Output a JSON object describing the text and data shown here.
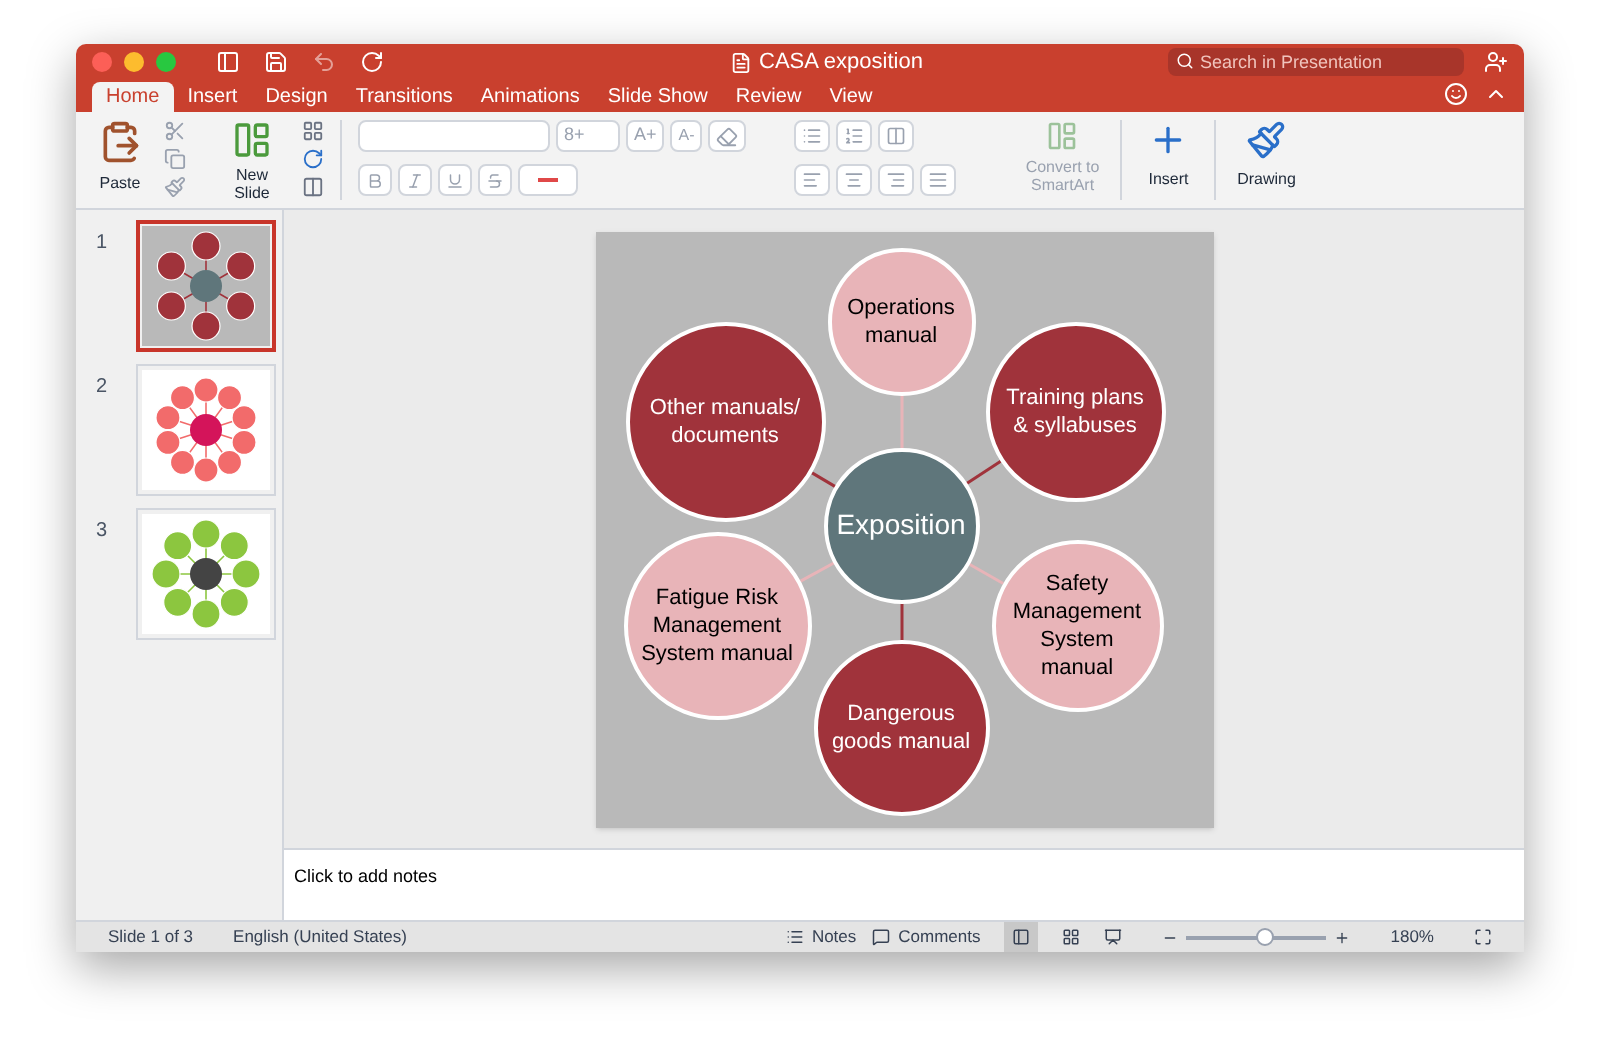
{
  "window": {
    "title": "CASA exposition"
  },
  "search": {
    "placeholder": "Search in Presentation"
  },
  "tabs": [
    {
      "label": "Home",
      "selected": true
    },
    {
      "label": "Insert",
      "selected": false
    },
    {
      "label": "Design",
      "selected": false
    },
    {
      "label": "Transitions",
      "selected": false
    },
    {
      "label": "Animations",
      "selected": false
    },
    {
      "label": "Slide Show",
      "selected": false
    },
    {
      "label": "Review",
      "selected": false
    },
    {
      "label": "View",
      "selected": false
    }
  ],
  "ribbon": {
    "paste": "Paste",
    "new_slide": "New Slide",
    "font_size": "8+",
    "grow_font": "A+",
    "shrink_font": "A-",
    "convert": "Convert to SmartArt",
    "insert": "Insert",
    "drawing": "Drawing"
  },
  "slides": [
    {
      "number": "1",
      "selected": true,
      "kind": "six",
      "color": "#a0333b"
    },
    {
      "number": "2",
      "selected": false,
      "kind": "ten",
      "color": "#f26b6b"
    },
    {
      "number": "3",
      "selected": false,
      "kind": "eight",
      "color": "#8cc63f"
    }
  ],
  "diagram": {
    "center": "Exposition",
    "nodes": [
      {
        "label": "Operations manual",
        "color": "#e8b4b8"
      },
      {
        "label": "Other manuals/ documents",
        "color": "#a0333b"
      },
      {
        "label": "Training plans & syllabuses",
        "color": "#a0333b"
      },
      {
        "label": "Fatigue Risk Management System manual",
        "color": "#e8b4b8"
      },
      {
        "label": "Safety Management System manual",
        "color": "#e8b4b8"
      },
      {
        "label": "Dangerous goods manual",
        "color": "#a0333b"
      }
    ]
  },
  "notes": {
    "placeholder": "Click to add notes"
  },
  "status_bar": {
    "slide": "Slide 1 of 3",
    "language": "English (United States)",
    "notes": "Notes",
    "comments": "Comments",
    "zoom": {
      "level": 0.55
    },
    "zoom_text": "180%"
  }
}
